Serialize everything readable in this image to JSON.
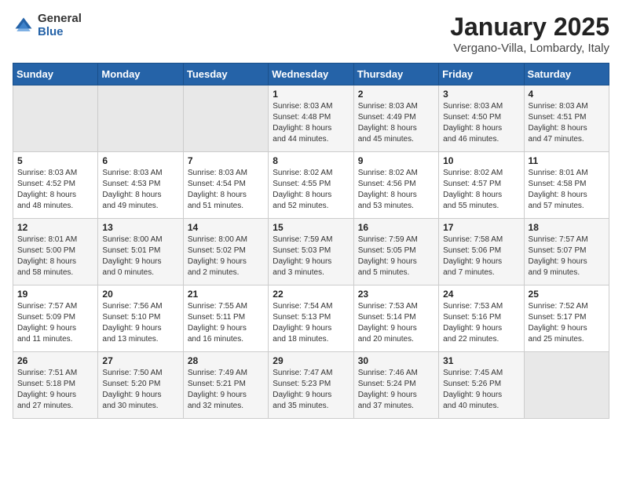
{
  "logo": {
    "general": "General",
    "blue": "Blue"
  },
  "title": "January 2025",
  "subtitle": "Vergano-Villa, Lombardy, Italy",
  "days_of_week": [
    "Sunday",
    "Monday",
    "Tuesday",
    "Wednesday",
    "Thursday",
    "Friday",
    "Saturday"
  ],
  "weeks": [
    [
      {
        "day": "",
        "info": ""
      },
      {
        "day": "",
        "info": ""
      },
      {
        "day": "",
        "info": ""
      },
      {
        "day": "1",
        "info": "Sunrise: 8:03 AM\nSunset: 4:48 PM\nDaylight: 8 hours\nand 44 minutes."
      },
      {
        "day": "2",
        "info": "Sunrise: 8:03 AM\nSunset: 4:49 PM\nDaylight: 8 hours\nand 45 minutes."
      },
      {
        "day": "3",
        "info": "Sunrise: 8:03 AM\nSunset: 4:50 PM\nDaylight: 8 hours\nand 46 minutes."
      },
      {
        "day": "4",
        "info": "Sunrise: 8:03 AM\nSunset: 4:51 PM\nDaylight: 8 hours\nand 47 minutes."
      }
    ],
    [
      {
        "day": "5",
        "info": "Sunrise: 8:03 AM\nSunset: 4:52 PM\nDaylight: 8 hours\nand 48 minutes."
      },
      {
        "day": "6",
        "info": "Sunrise: 8:03 AM\nSunset: 4:53 PM\nDaylight: 8 hours\nand 49 minutes."
      },
      {
        "day": "7",
        "info": "Sunrise: 8:03 AM\nSunset: 4:54 PM\nDaylight: 8 hours\nand 51 minutes."
      },
      {
        "day": "8",
        "info": "Sunrise: 8:02 AM\nSunset: 4:55 PM\nDaylight: 8 hours\nand 52 minutes."
      },
      {
        "day": "9",
        "info": "Sunrise: 8:02 AM\nSunset: 4:56 PM\nDaylight: 8 hours\nand 53 minutes."
      },
      {
        "day": "10",
        "info": "Sunrise: 8:02 AM\nSunset: 4:57 PM\nDaylight: 8 hours\nand 55 minutes."
      },
      {
        "day": "11",
        "info": "Sunrise: 8:01 AM\nSunset: 4:58 PM\nDaylight: 8 hours\nand 57 minutes."
      }
    ],
    [
      {
        "day": "12",
        "info": "Sunrise: 8:01 AM\nSunset: 5:00 PM\nDaylight: 8 hours\nand 58 minutes."
      },
      {
        "day": "13",
        "info": "Sunrise: 8:00 AM\nSunset: 5:01 PM\nDaylight: 9 hours\nand 0 minutes."
      },
      {
        "day": "14",
        "info": "Sunrise: 8:00 AM\nSunset: 5:02 PM\nDaylight: 9 hours\nand 2 minutes."
      },
      {
        "day": "15",
        "info": "Sunrise: 7:59 AM\nSunset: 5:03 PM\nDaylight: 9 hours\nand 3 minutes."
      },
      {
        "day": "16",
        "info": "Sunrise: 7:59 AM\nSunset: 5:05 PM\nDaylight: 9 hours\nand 5 minutes."
      },
      {
        "day": "17",
        "info": "Sunrise: 7:58 AM\nSunset: 5:06 PM\nDaylight: 9 hours\nand 7 minutes."
      },
      {
        "day": "18",
        "info": "Sunrise: 7:57 AM\nSunset: 5:07 PM\nDaylight: 9 hours\nand 9 minutes."
      }
    ],
    [
      {
        "day": "19",
        "info": "Sunrise: 7:57 AM\nSunset: 5:09 PM\nDaylight: 9 hours\nand 11 minutes."
      },
      {
        "day": "20",
        "info": "Sunrise: 7:56 AM\nSunset: 5:10 PM\nDaylight: 9 hours\nand 13 minutes."
      },
      {
        "day": "21",
        "info": "Sunrise: 7:55 AM\nSunset: 5:11 PM\nDaylight: 9 hours\nand 16 minutes."
      },
      {
        "day": "22",
        "info": "Sunrise: 7:54 AM\nSunset: 5:13 PM\nDaylight: 9 hours\nand 18 minutes."
      },
      {
        "day": "23",
        "info": "Sunrise: 7:53 AM\nSunset: 5:14 PM\nDaylight: 9 hours\nand 20 minutes."
      },
      {
        "day": "24",
        "info": "Sunrise: 7:53 AM\nSunset: 5:16 PM\nDaylight: 9 hours\nand 22 minutes."
      },
      {
        "day": "25",
        "info": "Sunrise: 7:52 AM\nSunset: 5:17 PM\nDaylight: 9 hours\nand 25 minutes."
      }
    ],
    [
      {
        "day": "26",
        "info": "Sunrise: 7:51 AM\nSunset: 5:18 PM\nDaylight: 9 hours\nand 27 minutes."
      },
      {
        "day": "27",
        "info": "Sunrise: 7:50 AM\nSunset: 5:20 PM\nDaylight: 9 hours\nand 30 minutes."
      },
      {
        "day": "28",
        "info": "Sunrise: 7:49 AM\nSunset: 5:21 PM\nDaylight: 9 hours\nand 32 minutes."
      },
      {
        "day": "29",
        "info": "Sunrise: 7:47 AM\nSunset: 5:23 PM\nDaylight: 9 hours\nand 35 minutes."
      },
      {
        "day": "30",
        "info": "Sunrise: 7:46 AM\nSunset: 5:24 PM\nDaylight: 9 hours\nand 37 minutes."
      },
      {
        "day": "31",
        "info": "Sunrise: 7:45 AM\nSunset: 5:26 PM\nDaylight: 9 hours\nand 40 minutes."
      },
      {
        "day": "",
        "info": ""
      }
    ]
  ]
}
